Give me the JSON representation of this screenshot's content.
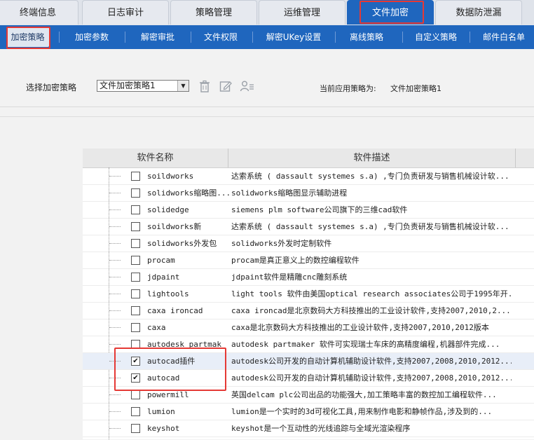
{
  "top_tabs": [
    "终端信息",
    "日志审计",
    "策略管理",
    "运维管理",
    "文件加密",
    "数据防泄漏"
  ],
  "sub_nav": [
    "加密策略",
    "加密参数",
    "解密审批",
    "文件权限",
    "解密UKey设置",
    "离线策略",
    "自定义策略",
    "邮件白名单"
  ],
  "toolbar": {
    "select_label": "选择加密策略",
    "select_value": "文件加密策略1",
    "current_label": "当前应用策略为:",
    "current_value": "文件加密策略1"
  },
  "table": {
    "headers": [
      "软件名称",
      "软件描述"
    ],
    "rows": [
      {
        "name": "soildworks",
        "desc": "达索系统 ( dassault systemes s.a) ,专门负责研发与销售机械设计软...",
        "checked": false
      },
      {
        "name": "solidworks缩略图...",
        "desc": "solidworks缩略图显示辅助进程",
        "checked": false
      },
      {
        "name": "solidedge",
        "desc": "siemens plm software公司旗下的三维cad软件",
        "checked": false
      },
      {
        "name": "soildworks新",
        "desc": "达索系统 ( dassault systemes s.a) ,专门负责研发与销售机械设计软...",
        "checked": false
      },
      {
        "name": "solidworks外发包",
        "desc": "solidworks外发时定制软件",
        "checked": false
      },
      {
        "name": "procam",
        "desc": "procam是真正意义上的数控编程软件",
        "checked": false
      },
      {
        "name": "jdpaint",
        "desc": "jdpaint软件是精雕cnc雕刻系统",
        "checked": false
      },
      {
        "name": "lightools",
        "desc": "light tools 软件由美国optical research associates公司于1995年开...",
        "checked": false
      },
      {
        "name": "caxa ironcad",
        "desc": "caxa ironcad是北京数码大方科技推出的工业设计软件,支持2007,2010,2...",
        "checked": false
      },
      {
        "name": "caxa",
        "desc": "caxa是北京数码大方科技推出的工业设计软件,支持2007,2010,2012版本",
        "checked": false
      },
      {
        "name": "autodesk partmak",
        "desc": "autodesk partmaker 软件可实现瑞士车床的高精度编程,机器部件完成...",
        "checked": false
      },
      {
        "name": "autocad插件",
        "desc": "autodesk公司开发的自动计算机辅助设计软件,支持2007,2008,2010,2012...",
        "checked": true
      },
      {
        "name": "autocad",
        "desc": "autodesk公司开发的自动计算机辅助设计软件,支持2007,2008,2010,2012...",
        "checked": true
      },
      {
        "name": "powermill",
        "desc": "英国delcam plc公司出品的功能强大,加工策略丰富的数控加工编程软件...",
        "checked": false
      },
      {
        "name": "lumion",
        "desc": "lumion是一个实时的3d可视化工具,用来制作电影和静帧作品,涉及到的...",
        "checked": false
      },
      {
        "name": "keyshot",
        "desc": "keyshot是一个互动性的光线追踪与全域光渲染程序",
        "checked": false
      }
    ]
  },
  "icons": [
    "trash-icon",
    "edit-icon",
    "user-settings-icon",
    "chevron-down-icon",
    "checkbox-icon"
  ],
  "colors": {
    "accent": "#1f66be",
    "highlight": "#e53935",
    "selected_row": "#e8eef8"
  }
}
